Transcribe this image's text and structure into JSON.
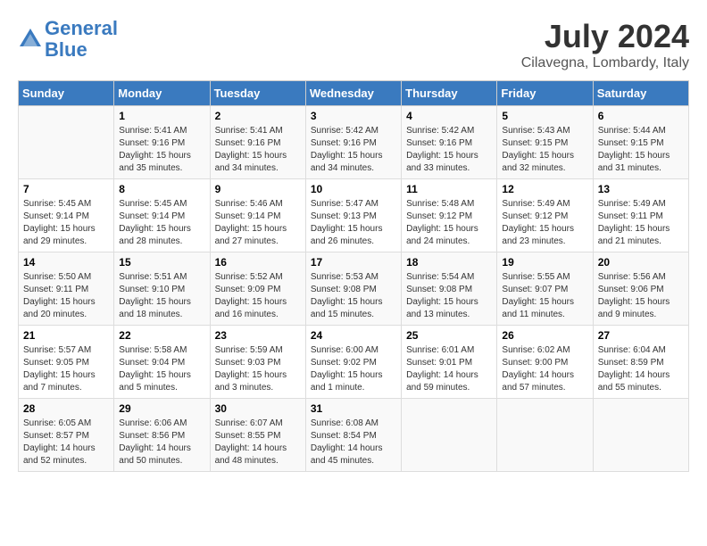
{
  "logo": {
    "line1": "General",
    "line2": "Blue"
  },
  "title": "July 2024",
  "location": "Cilavegna, Lombardy, Italy",
  "days_of_week": [
    "Sunday",
    "Monday",
    "Tuesday",
    "Wednesday",
    "Thursday",
    "Friday",
    "Saturday"
  ],
  "weeks": [
    [
      {
        "num": "",
        "sunrise": "",
        "sunset": "",
        "daylight": ""
      },
      {
        "num": "1",
        "sunrise": "Sunrise: 5:41 AM",
        "sunset": "Sunset: 9:16 PM",
        "daylight": "Daylight: 15 hours and 35 minutes."
      },
      {
        "num": "2",
        "sunrise": "Sunrise: 5:41 AM",
        "sunset": "Sunset: 9:16 PM",
        "daylight": "Daylight: 15 hours and 34 minutes."
      },
      {
        "num": "3",
        "sunrise": "Sunrise: 5:42 AM",
        "sunset": "Sunset: 9:16 PM",
        "daylight": "Daylight: 15 hours and 34 minutes."
      },
      {
        "num": "4",
        "sunrise": "Sunrise: 5:42 AM",
        "sunset": "Sunset: 9:16 PM",
        "daylight": "Daylight: 15 hours and 33 minutes."
      },
      {
        "num": "5",
        "sunrise": "Sunrise: 5:43 AM",
        "sunset": "Sunset: 9:15 PM",
        "daylight": "Daylight: 15 hours and 32 minutes."
      },
      {
        "num": "6",
        "sunrise": "Sunrise: 5:44 AM",
        "sunset": "Sunset: 9:15 PM",
        "daylight": "Daylight: 15 hours and 31 minutes."
      }
    ],
    [
      {
        "num": "7",
        "sunrise": "Sunrise: 5:45 AM",
        "sunset": "Sunset: 9:14 PM",
        "daylight": "Daylight: 15 hours and 29 minutes."
      },
      {
        "num": "8",
        "sunrise": "Sunrise: 5:45 AM",
        "sunset": "Sunset: 9:14 PM",
        "daylight": "Daylight: 15 hours and 28 minutes."
      },
      {
        "num": "9",
        "sunrise": "Sunrise: 5:46 AM",
        "sunset": "Sunset: 9:14 PM",
        "daylight": "Daylight: 15 hours and 27 minutes."
      },
      {
        "num": "10",
        "sunrise": "Sunrise: 5:47 AM",
        "sunset": "Sunset: 9:13 PM",
        "daylight": "Daylight: 15 hours and 26 minutes."
      },
      {
        "num": "11",
        "sunrise": "Sunrise: 5:48 AM",
        "sunset": "Sunset: 9:12 PM",
        "daylight": "Daylight: 15 hours and 24 minutes."
      },
      {
        "num": "12",
        "sunrise": "Sunrise: 5:49 AM",
        "sunset": "Sunset: 9:12 PM",
        "daylight": "Daylight: 15 hours and 23 minutes."
      },
      {
        "num": "13",
        "sunrise": "Sunrise: 5:49 AM",
        "sunset": "Sunset: 9:11 PM",
        "daylight": "Daylight: 15 hours and 21 minutes."
      }
    ],
    [
      {
        "num": "14",
        "sunrise": "Sunrise: 5:50 AM",
        "sunset": "Sunset: 9:11 PM",
        "daylight": "Daylight: 15 hours and 20 minutes."
      },
      {
        "num": "15",
        "sunrise": "Sunrise: 5:51 AM",
        "sunset": "Sunset: 9:10 PM",
        "daylight": "Daylight: 15 hours and 18 minutes."
      },
      {
        "num": "16",
        "sunrise": "Sunrise: 5:52 AM",
        "sunset": "Sunset: 9:09 PM",
        "daylight": "Daylight: 15 hours and 16 minutes."
      },
      {
        "num": "17",
        "sunrise": "Sunrise: 5:53 AM",
        "sunset": "Sunset: 9:08 PM",
        "daylight": "Daylight: 15 hours and 15 minutes."
      },
      {
        "num": "18",
        "sunrise": "Sunrise: 5:54 AM",
        "sunset": "Sunset: 9:08 PM",
        "daylight": "Daylight: 15 hours and 13 minutes."
      },
      {
        "num": "19",
        "sunrise": "Sunrise: 5:55 AM",
        "sunset": "Sunset: 9:07 PM",
        "daylight": "Daylight: 15 hours and 11 minutes."
      },
      {
        "num": "20",
        "sunrise": "Sunrise: 5:56 AM",
        "sunset": "Sunset: 9:06 PM",
        "daylight": "Daylight: 15 hours and 9 minutes."
      }
    ],
    [
      {
        "num": "21",
        "sunrise": "Sunrise: 5:57 AM",
        "sunset": "Sunset: 9:05 PM",
        "daylight": "Daylight: 15 hours and 7 minutes."
      },
      {
        "num": "22",
        "sunrise": "Sunrise: 5:58 AM",
        "sunset": "Sunset: 9:04 PM",
        "daylight": "Daylight: 15 hours and 5 minutes."
      },
      {
        "num": "23",
        "sunrise": "Sunrise: 5:59 AM",
        "sunset": "Sunset: 9:03 PM",
        "daylight": "Daylight: 15 hours and 3 minutes."
      },
      {
        "num": "24",
        "sunrise": "Sunrise: 6:00 AM",
        "sunset": "Sunset: 9:02 PM",
        "daylight": "Daylight: 15 hours and 1 minute."
      },
      {
        "num": "25",
        "sunrise": "Sunrise: 6:01 AM",
        "sunset": "Sunset: 9:01 PM",
        "daylight": "Daylight: 14 hours and 59 minutes."
      },
      {
        "num": "26",
        "sunrise": "Sunrise: 6:02 AM",
        "sunset": "Sunset: 9:00 PM",
        "daylight": "Daylight: 14 hours and 57 minutes."
      },
      {
        "num": "27",
        "sunrise": "Sunrise: 6:04 AM",
        "sunset": "Sunset: 8:59 PM",
        "daylight": "Daylight: 14 hours and 55 minutes."
      }
    ],
    [
      {
        "num": "28",
        "sunrise": "Sunrise: 6:05 AM",
        "sunset": "Sunset: 8:57 PM",
        "daylight": "Daylight: 14 hours and 52 minutes."
      },
      {
        "num": "29",
        "sunrise": "Sunrise: 6:06 AM",
        "sunset": "Sunset: 8:56 PM",
        "daylight": "Daylight: 14 hours and 50 minutes."
      },
      {
        "num": "30",
        "sunrise": "Sunrise: 6:07 AM",
        "sunset": "Sunset: 8:55 PM",
        "daylight": "Daylight: 14 hours and 48 minutes."
      },
      {
        "num": "31",
        "sunrise": "Sunrise: 6:08 AM",
        "sunset": "Sunset: 8:54 PM",
        "daylight": "Daylight: 14 hours and 45 minutes."
      },
      {
        "num": "",
        "sunrise": "",
        "sunset": "",
        "daylight": ""
      },
      {
        "num": "",
        "sunrise": "",
        "sunset": "",
        "daylight": ""
      },
      {
        "num": "",
        "sunrise": "",
        "sunset": "",
        "daylight": ""
      }
    ]
  ]
}
